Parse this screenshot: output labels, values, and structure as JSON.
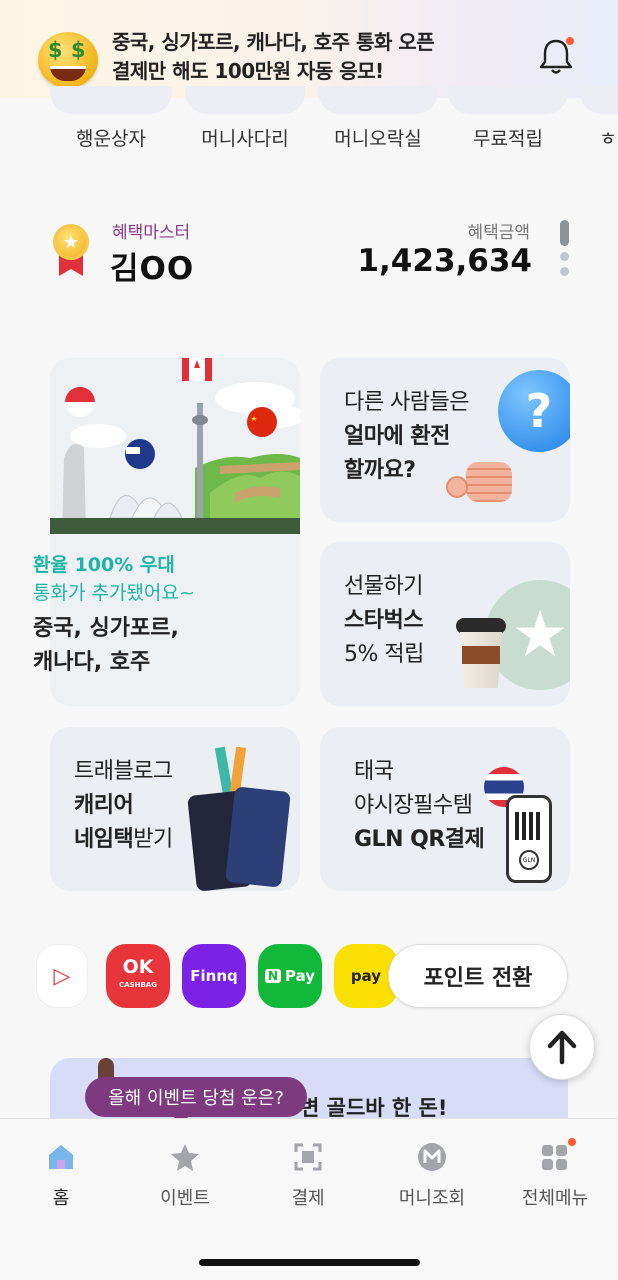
{
  "banner": {
    "line1": "중국, 싱가포르, 캐나다, 호주 통화 오픈",
    "line2": "결제만 해도 100만원 자동 응모!",
    "icon": "money-face-emoji",
    "bell_icon": "bell-icon"
  },
  "categories": [
    {
      "label": "행운상자"
    },
    {
      "label": "머니사다리"
    },
    {
      "label": "머니오락실"
    },
    {
      "label": "무료적립"
    },
    {
      "label": "ㅎ"
    }
  ],
  "profile": {
    "grade": "혜택마스터",
    "name": "김OO",
    "benefit_label": "혜택금액",
    "benefit_amount": "1,423,634"
  },
  "cards": {
    "big": {
      "highlight": "환율 100% 우대",
      "sub": "통화가 추가됐어요~",
      "title_line1": "중국, 싱가포르,",
      "title_line2": "캐나다, 호주"
    },
    "exchange": {
      "line1": "다른 사람들은",
      "line2": "얼마에 환전",
      "line3": "할까요?"
    },
    "starbucks": {
      "line1": "선물하기",
      "line2": "스타벅스",
      "line3": "5% 적립"
    },
    "travelog": {
      "line1": "트래블로그",
      "line2": "캐리어",
      "line3a": "네임택",
      "line3b": "받기"
    },
    "thai": {
      "line1": "태국",
      "line2": "야시장필수템",
      "line3": "GLN QR결제"
    }
  },
  "pay_services": [
    {
      "label": "OK",
      "sub": "CASHBAG"
    },
    {
      "label": "Finnq"
    },
    {
      "label": "Pay",
      "badge": "N"
    },
    {
      "label": "pay"
    }
  ],
  "point_button": "포인트 전환",
  "promo": {
    "text": "변 골드바 한 돈!"
  },
  "tooltip": "올해 이벤트 당첨 운은?",
  "nav": [
    {
      "label": "홈",
      "icon": "home-icon"
    },
    {
      "label": "이벤트",
      "icon": "star-icon"
    },
    {
      "label": "결제",
      "icon": "scan-icon"
    },
    {
      "label": "머니조회",
      "icon": "money-m-icon"
    },
    {
      "label": "전체메뉴",
      "icon": "grid-menu-icon"
    }
  ],
  "colors": {
    "accent_purple": "#7d3a7e",
    "teal": "#1fb5a6",
    "ok_red": "#e8343b",
    "finnq_purple": "#7b22e6",
    "npay_green": "#12b83a",
    "kakao_yellow": "#f9e000"
  }
}
